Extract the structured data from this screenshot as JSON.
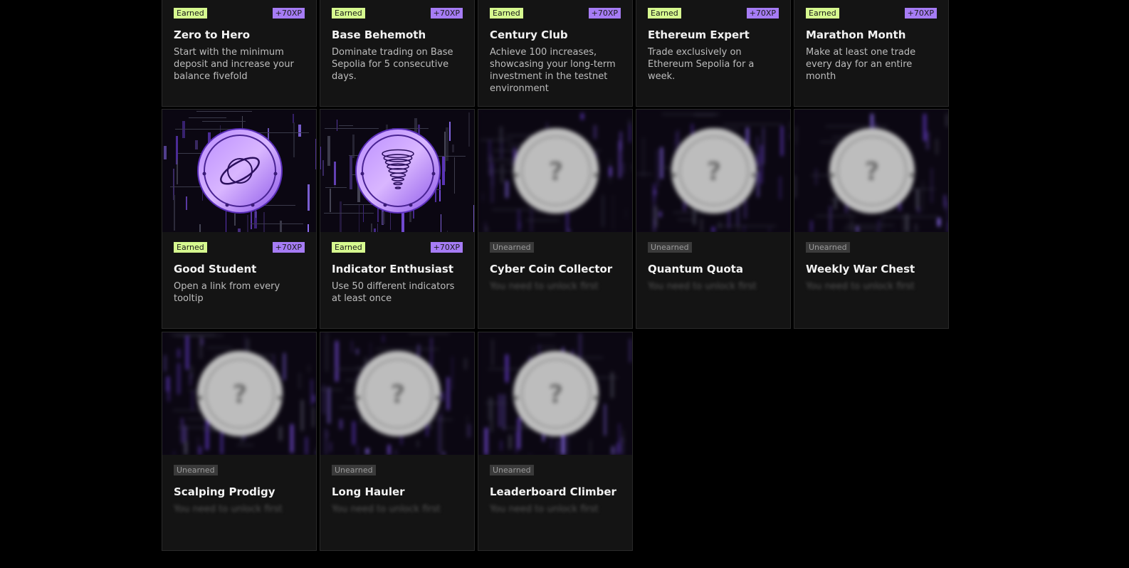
{
  "achievements": [
    {
      "badge": "Earned",
      "xp": "+70XP",
      "title": "Zero to Hero",
      "description": "Start with the minimum deposit and increase your balance fivefold",
      "status": "earned",
      "icon": "none"
    },
    {
      "badge": "Earned",
      "xp": "+70XP",
      "title": "Base Behemoth",
      "description": "Dominate trading on Base Sepolia for 5 consecutive days.",
      "status": "earned",
      "icon": "none"
    },
    {
      "badge": "Earned",
      "xp": "+70XP",
      "title": "Century Club",
      "description": "Achieve 100 increases, showcasing your long-term investment in the testnet environment",
      "status": "earned",
      "icon": "none"
    },
    {
      "badge": "Earned",
      "xp": "+70XP",
      "title": "Ethereum Expert",
      "description": "Trade exclusively on Ethereum Sepolia for a week.",
      "status": "earned",
      "icon": "none"
    },
    {
      "badge": "Earned",
      "xp": "+70XP",
      "title": "Marathon Month",
      "description": "Make at least one trade every day for an entire month",
      "status": "earned",
      "icon": "none"
    },
    {
      "badge": "Earned",
      "xp": "+70XP",
      "title": "Good Student",
      "description": "Open a link from every tooltip",
      "status": "earned",
      "icon": "orbit-coin-icon"
    },
    {
      "badge": "Earned",
      "xp": "+70XP",
      "title": "Indicator Enthusiast",
      "description": "Use 50 different indicators at least once",
      "status": "earned",
      "icon": "funnel-coin-icon"
    },
    {
      "badge": "Unearned",
      "xp": "",
      "title": "Cyber Coin Collector",
      "description": "You need to unlock first",
      "status": "locked",
      "icon": "question-coin-icon"
    },
    {
      "badge": "Unearned",
      "xp": "",
      "title": "Quantum Quota",
      "description": "You need to unlock first",
      "status": "locked",
      "icon": "question-coin-icon"
    },
    {
      "badge": "Unearned",
      "xp": "",
      "title": "Weekly War Chest",
      "description": "You need to unlock first",
      "status": "locked",
      "icon": "question-coin-icon"
    },
    {
      "badge": "Unearned",
      "xp": "",
      "title": "Scalping Prodigy",
      "description": "You need to unlock first",
      "status": "locked",
      "icon": "question-coin-icon"
    },
    {
      "badge": "Unearned",
      "xp": "",
      "title": "Long Hauler",
      "description": "You need to unlock first",
      "status": "locked",
      "icon": "question-coin-icon"
    },
    {
      "badge": "Unearned",
      "xp": "",
      "title": "Leaderboard Climber",
      "description": "You need to unlock first",
      "status": "locked",
      "icon": "question-coin-icon"
    }
  ],
  "colors": {
    "earned_badge": "#d6f98f",
    "xp_badge": "#a67cf5",
    "unearned_badge": "#3a3a3a",
    "card_bg": "#141414",
    "coin_purple": "#a77cf0"
  }
}
